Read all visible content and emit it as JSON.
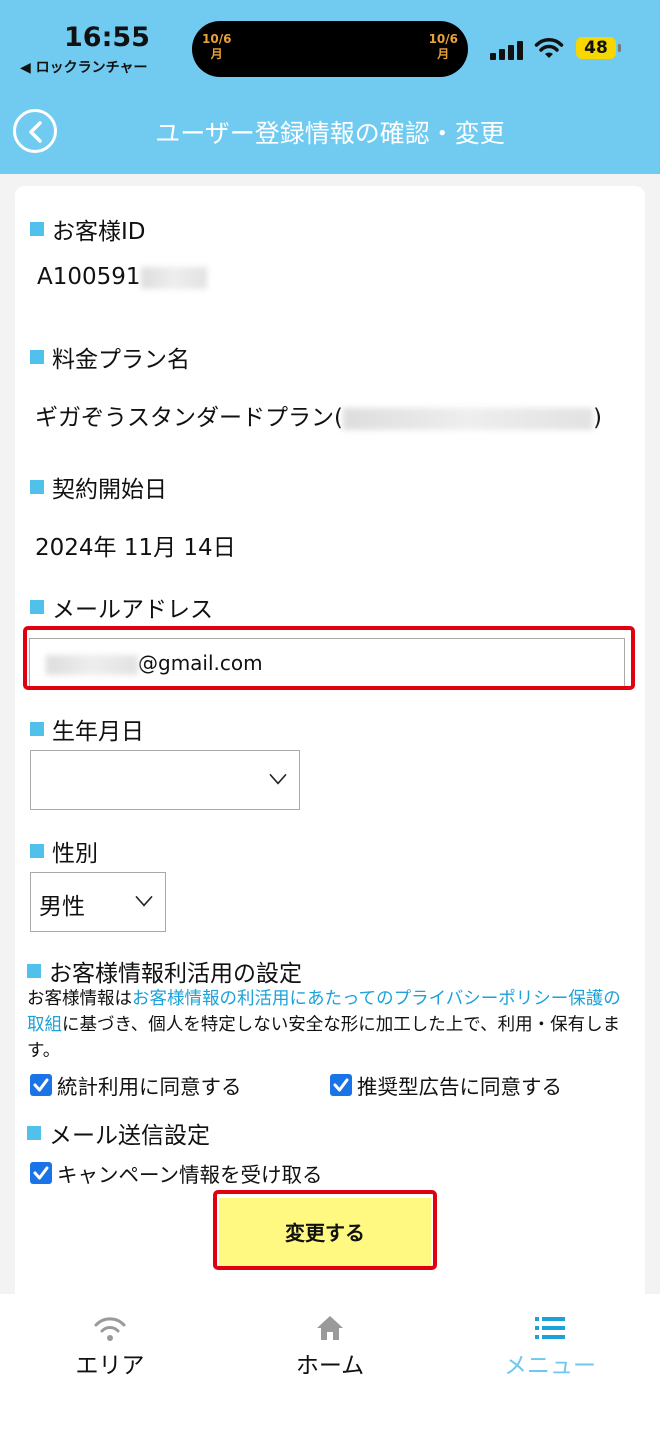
{
  "status_bar": {
    "time": "16:55",
    "back_app": "◀ ロックランチャー",
    "island_left_date": "10/6",
    "island_left_day": "月",
    "island_right_date": "10/6",
    "island_right_day": "月",
    "battery": "48"
  },
  "header": {
    "title": "ユーザー登録情報の確認・変更"
  },
  "sections": {
    "customer_id_label": "お客様ID",
    "customer_id_value": "A100591",
    "plan_label": "料金プラン名",
    "plan_value_prefix": "ギガぞうスタンダードプラン(",
    "plan_value_suffix": ")",
    "start_date_label": "契約開始日",
    "start_date_value": "2024年 11月 14日",
    "email_label": "メールアドレス",
    "email_value_suffix": "@gmail.com",
    "birthday_label": "生年月日",
    "birthday_value": "",
    "gender_label": "性別",
    "gender_value": "男性",
    "usage_label": "お客様情報利活用の設定",
    "usage_note_1": "お客様情報は",
    "usage_note_link": "お客様情報の利活用にあたってのプライバシーポリシー保護の取組",
    "usage_note_2": "に基づき、個人を特定しない安全な形に加工した上で、利用・保有します。",
    "stats_checkbox": "統計利用に同意する",
    "ads_checkbox": "推奨型広告に同意する",
    "mail_label": "メール送信設定",
    "campaign_checkbox": "キャンペーン情報を受け取る",
    "submit": "変更する"
  },
  "tabbar": {
    "area": "エリア",
    "home": "ホーム",
    "menu": "メニュー"
  },
  "colors": {
    "header_bg": "#71cbf0",
    "accent": "#4fc1ea",
    "link": "#1ca2d8",
    "highlight": "#e00010",
    "submit_bg": "#fff981"
  }
}
